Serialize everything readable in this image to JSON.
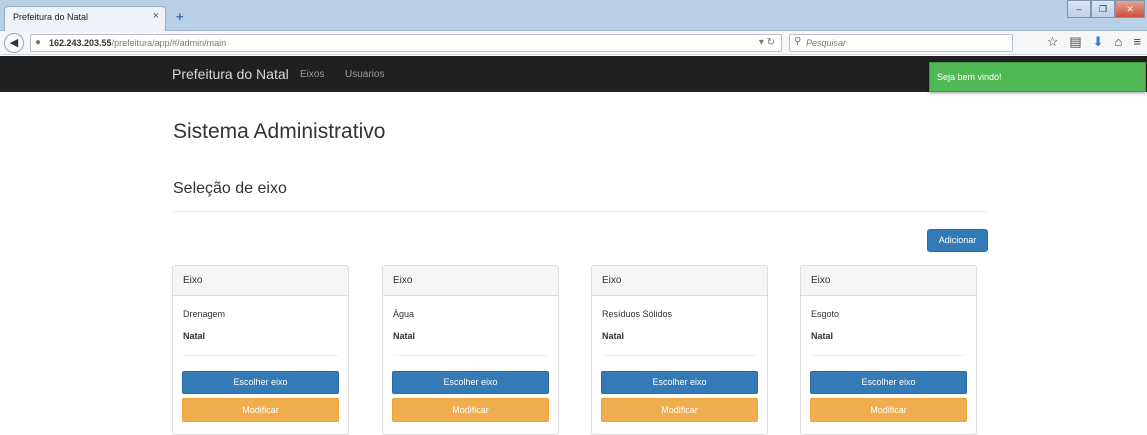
{
  "browser": {
    "tab_title": "Prefeitura do Natal",
    "tab_close": "×",
    "new_tab": "+",
    "url_host": "162.243.203.55",
    "url_path": "/prefeitura/app/#/admin/main",
    "search_placeholder": "Pesquisar",
    "icons": [
      "back-icon",
      "lock-icon",
      "reload-icon",
      "search-icon",
      "bookmark-star-icon",
      "bookmarks-list-icon",
      "download-icon",
      "home-icon",
      "menu-icon"
    ]
  },
  "nav": {
    "brand": "Prefeitura do Natal",
    "links": [
      "Eixos",
      "Usuarios"
    ]
  },
  "toast": {
    "message": "Seja bem vindo!",
    "color": "#51b856"
  },
  "main": {
    "title": "Sistema Administrativo",
    "section": "Seleção de eixo",
    "add_label": "Adicionar"
  },
  "cards": [
    {
      "header": "Eixo",
      "name": "Drenagem",
      "city": "Natal",
      "choose": "Escolher eixo",
      "edit": "Modificar"
    },
    {
      "header": "Eixo",
      "name": "Água",
      "city": "Natal",
      "choose": "Escolher eixo",
      "edit": "Modificar"
    },
    {
      "header": "Eixo",
      "name": "Resíduos Sólidos",
      "city": "Natal",
      "choose": "Escolher eixo",
      "edit": "Modificar"
    },
    {
      "header": "Eixo",
      "name": "Esgoto",
      "city": "Natal",
      "choose": "Escolher eixo",
      "edit": "Modificar"
    }
  ],
  "colors": {
    "primary": "#337ab7",
    "warning": "#f0ad4e",
    "navbar": "#202020"
  }
}
